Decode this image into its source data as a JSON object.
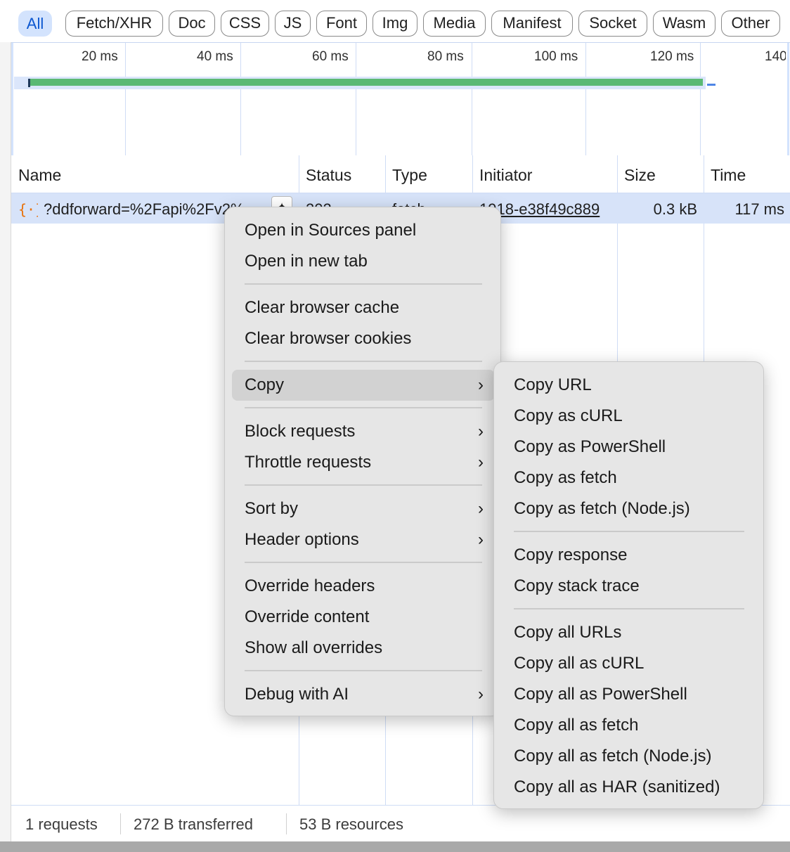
{
  "filters": [
    {
      "label": "All",
      "active": true
    },
    {
      "label": "Fetch/XHR"
    },
    {
      "label": "Doc"
    },
    {
      "label": "CSS"
    },
    {
      "label": "JS"
    },
    {
      "label": "Font"
    },
    {
      "label": "Img"
    },
    {
      "label": "Media"
    },
    {
      "label": "Manifest"
    },
    {
      "label": "Socket"
    },
    {
      "label": "Wasm"
    },
    {
      "label": "Other"
    }
  ],
  "timeline": {
    "ticks": [
      "20 ms",
      "40 ms",
      "60 ms",
      "80 ms",
      "100 ms",
      "120 ms",
      "140"
    ]
  },
  "table": {
    "columns": [
      "Name",
      "Status",
      "Type",
      "Initiator",
      "Size",
      "Time"
    ],
    "rows": [
      {
        "name": "?ddforward=%2Fapi%2Fv2%",
        "status": "202",
        "type": "fetch",
        "initiator": "1918-e38f49c889",
        "size": "0.3 kB",
        "time": "117 ms"
      }
    ]
  },
  "status_bar": {
    "requests": "1 requests",
    "transferred": "272 B transferred",
    "resources": "53 B resources"
  },
  "context_menu": {
    "items": [
      "Open in Sources panel",
      "Open in new tab",
      "Clear browser cache",
      "Clear browser cookies",
      "Copy",
      "Block requests",
      "Throttle requests",
      "Sort by",
      "Header options",
      "Override headers",
      "Override content",
      "Show all overrides",
      "Debug with AI"
    ]
  },
  "copy_submenu": {
    "items": [
      "Copy URL",
      "Copy as cURL",
      "Copy as PowerShell",
      "Copy as fetch",
      "Copy as fetch (Node.js)",
      "Copy response",
      "Copy stack trace",
      "Copy all URLs",
      "Copy all as cURL",
      "Copy all as PowerShell",
      "Copy all as fetch",
      "Copy all as fetch (Node.js)",
      "Copy all as HAR (sanitized)"
    ]
  },
  "icons": {
    "request_type": "fetch-braces-icon",
    "submenu": "chevron-right-icon",
    "ai_assist": "sparkle-edit-icon"
  },
  "colors": {
    "accent": "#0b57d0",
    "selected_row": "#d7e3f9",
    "waterfall_bar": "#5bb974",
    "fetch_icon": "#e8710a"
  }
}
